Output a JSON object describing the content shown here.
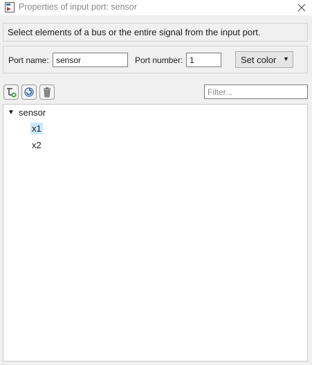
{
  "window": {
    "title": "Properties of input port: sensor",
    "icon": "port-properties-icon"
  },
  "description": "Select elements of a bus or the entire signal from the input port.",
  "port": {
    "name_label": "Port name:",
    "name_value": "sensor",
    "number_label": "Port number:",
    "number_value": "1",
    "set_color_label": "Set color"
  },
  "toolbar": {
    "icons": [
      "add-element-icon",
      "refresh-icon",
      "delete-icon"
    ]
  },
  "filter": {
    "placeholder": "Filter..."
  },
  "tree": {
    "root": {
      "label": "sensor",
      "expanded": true
    },
    "children": [
      {
        "label": "x1",
        "selected": true
      },
      {
        "label": "x2",
        "selected": false
      }
    ]
  },
  "colors": {
    "selection": "#cce8ff",
    "title_text": "#8a8a8a"
  }
}
